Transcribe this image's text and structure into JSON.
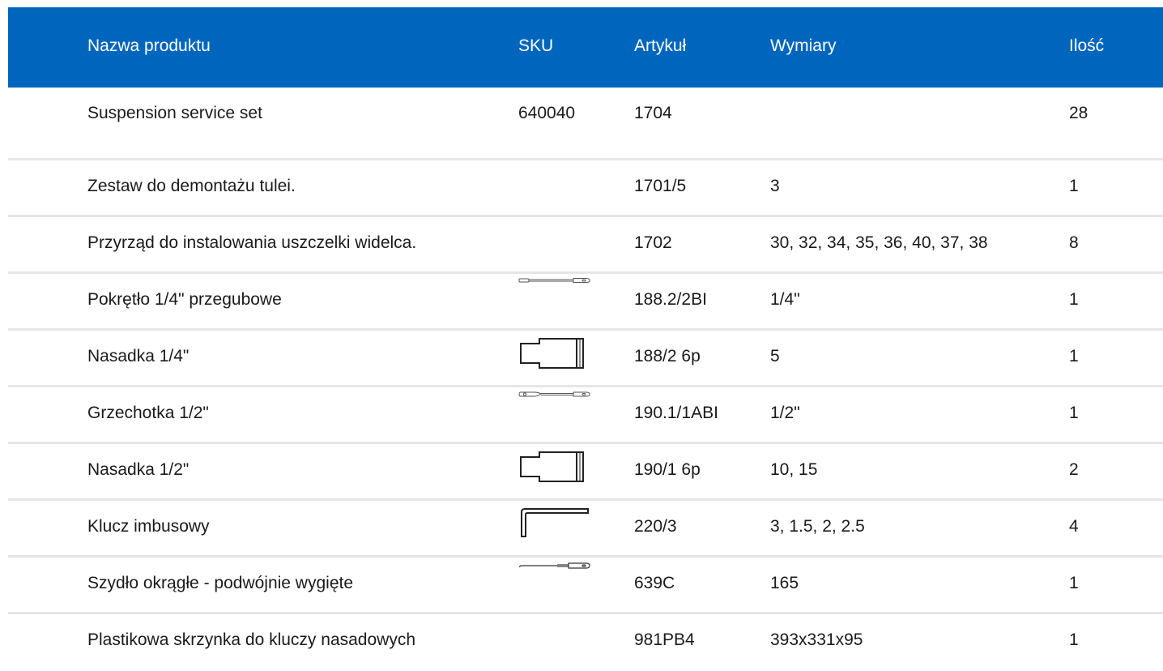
{
  "header": {
    "name": "Nazwa produktu",
    "sku": "SKU",
    "article": "Artykuł",
    "dimensions": "Wymiary",
    "quantity": "Ilość"
  },
  "colors": {
    "header_bg": "#0066bd",
    "header_text": "#ffffff",
    "divider": "#e6e6e6"
  },
  "rows": [
    {
      "name": "Suspension service set",
      "sku": "640040",
      "article": "1704",
      "dimensions": "",
      "quantity": "28",
      "icon": ""
    },
    {
      "name": "Zestaw do demontażu tulei.",
      "sku": "",
      "article": "1701/5",
      "dimensions": "3",
      "quantity": "1",
      "icon": ""
    },
    {
      "name": "Przyrząd do instalowania uszczelki widelca.",
      "sku": "",
      "article": "1702",
      "dimensions": "30, 32, 34, 35, 36, 40, 37, 38",
      "quantity": "8",
      "icon": ""
    },
    {
      "name": "Pokrętło 1/4\" przegubowe",
      "sku": "",
      "article": "188.2/2BI",
      "dimensions": "1/4\"",
      "quantity": "1",
      "icon": "hinged-handle-icon"
    },
    {
      "name": "Nasadka 1/4\"",
      "sku": "",
      "article": "188/2 6p",
      "dimensions": "5",
      "quantity": "1",
      "icon": "socket-icon"
    },
    {
      "name": "Grzechotka 1/2\"",
      "sku": "",
      "article": "190.1/1ABI",
      "dimensions": "1/2\"",
      "quantity": "1",
      "icon": "ratchet-icon"
    },
    {
      "name": "Nasadka 1/2\"",
      "sku": "",
      "article": "190/1 6p",
      "dimensions": "10, 15",
      "quantity": "2",
      "icon": "socket-icon"
    },
    {
      "name": "Klucz imbusowy",
      "sku": "",
      "article": "220/3",
      "dimensions": "3, 1.5, 2, 2.5",
      "quantity": "4",
      "icon": "hex-key-icon"
    },
    {
      "name": "Szydło okrągłe - podwójnie wygięte",
      "sku": "",
      "article": "639C",
      "dimensions": "165",
      "quantity": "1",
      "icon": "awl-icon"
    },
    {
      "name": "Plastikowa skrzynka do kluczy nasadowych",
      "sku": "",
      "article": "981PB4",
      "dimensions": "393x331x95",
      "quantity": "1",
      "icon": ""
    }
  ]
}
